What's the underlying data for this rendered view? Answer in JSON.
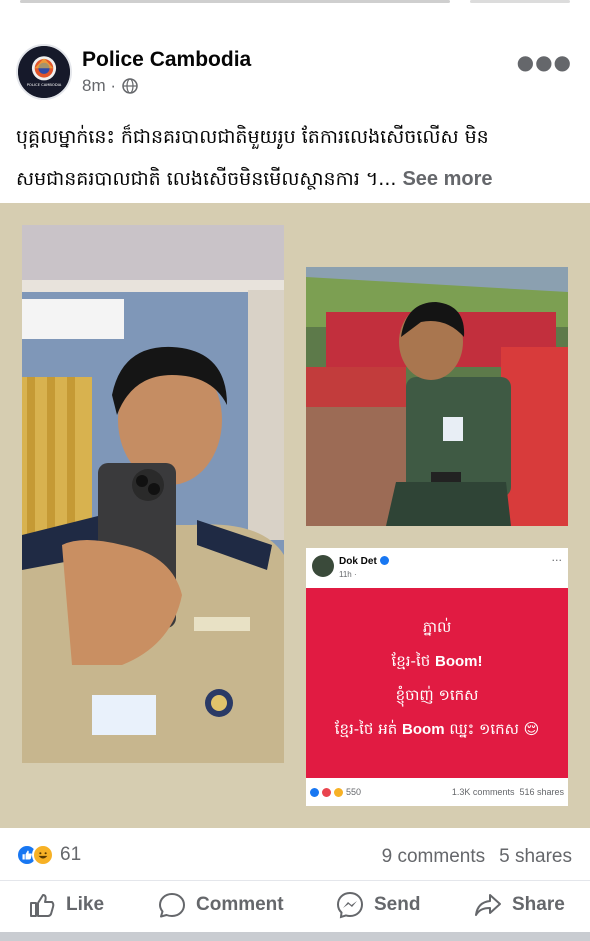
{
  "post": {
    "author": "Police Cambodia",
    "time": "8m ·",
    "caption_line1": "បុគ្គលម្នាក់នេះ ក៏ជានគរបាលជាតិមួយរូប តែការលេងសើចលើស មិន",
    "caption_line2": "សមជានគរបាលជាតិ លេងសើចមិនមើលស្ថានការ ។...",
    "see_more": "See more",
    "avatar_logo_text": "POLICE CAMBODIA"
  },
  "embedded_post": {
    "author": "Dok Det",
    "time": "11h ·",
    "line1": "ភ្នាល់",
    "line2_prefix": "ខ្មែរ-ថៃ",
    "line2_bold": "Boom!",
    "line3": "ខ្ញុំចាញ់ ១កេស",
    "line4_prefix": "ខ្មែរ-ថៃ អត់",
    "line4_bold": "Boom",
    "line4_suffix": "ឈ្នះ ១កេស 😌",
    "reactions_count": "550",
    "comments": "1.3K comments",
    "shares": "516 shares"
  },
  "stats": {
    "reactions_count": "61",
    "comments": "9 comments",
    "shares": "5 shares"
  },
  "actions": {
    "like": "Like",
    "comment": "Comment",
    "send": "Send",
    "share": "Share"
  },
  "colors": {
    "media_bg": "#d6cdb1",
    "red_card": "#e11b42",
    "fb_blue": "#1877f2",
    "secondary_text": "#65676b"
  },
  "icons": [
    "globe-icon",
    "more-icon",
    "like-icon",
    "comment-icon",
    "send-icon",
    "share-icon",
    "like-reaction-icon",
    "haha-reaction-icon",
    "verified-badge-icon"
  ]
}
